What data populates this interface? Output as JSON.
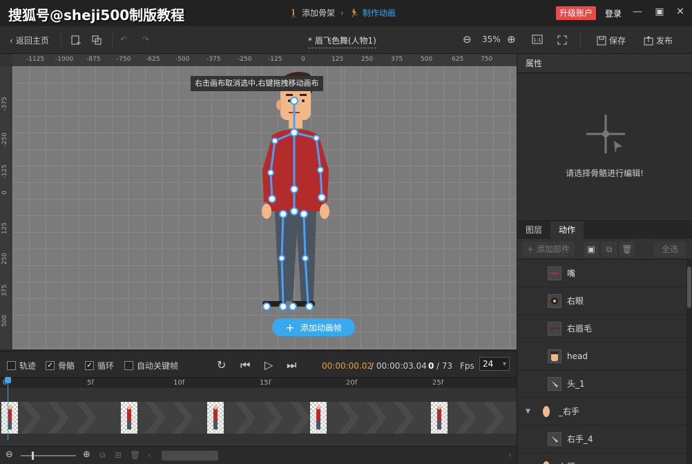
{
  "watermark": "搜狐号@sheji500制版教程",
  "steps": [
    {
      "label": "添加骨架",
      "icon": "skeleton-icon"
    },
    {
      "label": "制作动画",
      "icon": "run-icon"
    }
  ],
  "account": {
    "upgrade": "升级账户",
    "login": "登录"
  },
  "toolbar": {
    "back": "返回主页",
    "doc_title": "* 眉飞色舞(人物1)",
    "zoom": "35%",
    "save": "保存",
    "publish": "发布"
  },
  "ruler": {
    "h_ticks": [
      "-1125",
      "-1000",
      "-875",
      "-750",
      "-625",
      "-500",
      "-375",
      "-250",
      "-125",
      "0",
      "125",
      "250",
      "375",
      "500",
      "625",
      "750"
    ],
    "v_ticks": [
      "-375",
      "-250",
      "-125",
      "0",
      "125",
      "250",
      "375",
      "500"
    ]
  },
  "canvas": {
    "tooltip": "右击画布取消选中,右键拖拽移动画布",
    "add_frame": "添加动画帧"
  },
  "playbar": {
    "trail": "轨迹",
    "bones": "骨骼",
    "loop": "循环",
    "auto_key": "自动关键帧",
    "current_time": "00:00:00.02",
    "total_time": "/ 00:00:03.04",
    "frame": "0",
    "frame_total": "/ 73",
    "fps_label": "Fps",
    "fps": "24"
  },
  "timeline": {
    "ticks": [
      "0",
      "5f",
      "10f",
      "15f",
      "20f",
      "25f"
    ]
  },
  "panel": {
    "properties": "属性",
    "props_tip": "请选择骨骼进行编辑!",
    "tabs": [
      "图层",
      "动作"
    ],
    "add_part": "+ 添加部件",
    "select_all": "全选",
    "layers": [
      {
        "name": "嘴",
        "indent": true
      },
      {
        "name": "右眼",
        "indent": true
      },
      {
        "name": "右眉毛",
        "indent": true
      },
      {
        "name": "head",
        "indent": true
      },
      {
        "name": "头_1",
        "indent": true
      },
      {
        "name": "_右手",
        "indent": false,
        "group": true
      },
      {
        "name": "右手_4",
        "indent": true
      },
      {
        "name": "右臂",
        "indent": false,
        "group": true
      }
    ]
  },
  "colors": {
    "accent": "#3aa8ef",
    "upgrade": "#e84a4a",
    "time_current": "#e8a04a"
  }
}
